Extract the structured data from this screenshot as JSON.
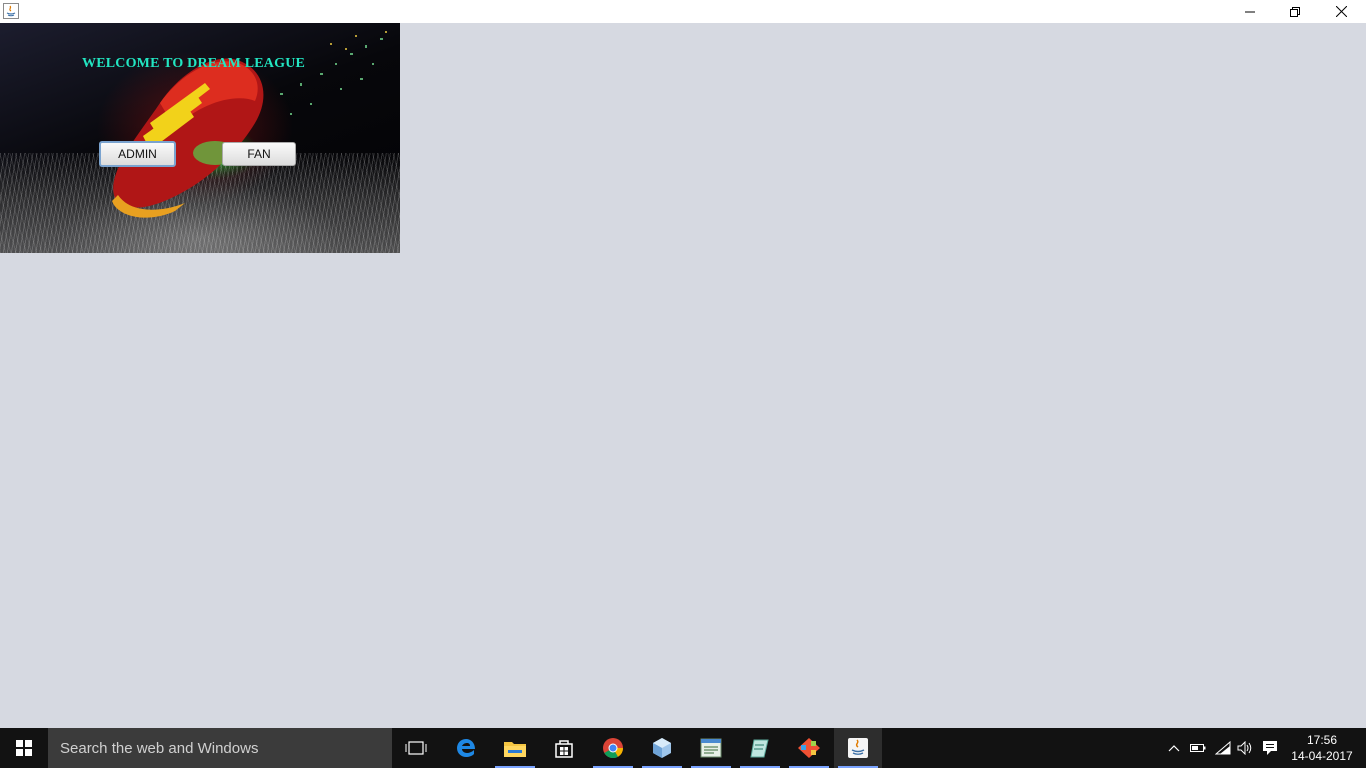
{
  "window": {
    "title": "",
    "icon": "java-icon",
    "controls": [
      "minimize-icon",
      "restore-icon",
      "close-icon"
    ]
  },
  "panel": {
    "title": "WELCOME TO DREAM  LEAGUE",
    "admin_label": "ADMIN",
    "fan_label": "FAN",
    "title_color": "#22e6c2"
  },
  "taskbar": {
    "search_placeholder": "Search the web and Windows",
    "pinned": [
      "task-view-icon",
      "edge-icon",
      "file-explorer-icon",
      "store-icon",
      "chrome-icon",
      "virtualbox-icon",
      "notepad-icon",
      "notepad-plus-icon",
      "git-icon",
      "java-icon"
    ],
    "tray": [
      "chevron-up-icon",
      "battery-icon",
      "wifi-icon",
      "volume-icon",
      "notifications-icon"
    ],
    "time": "17:56",
    "date": "14-04-2017"
  },
  "colors": {
    "desktop": "#d6d9e1",
    "taskbar": "#121212",
    "running_indicator": "#7aa3ff"
  }
}
